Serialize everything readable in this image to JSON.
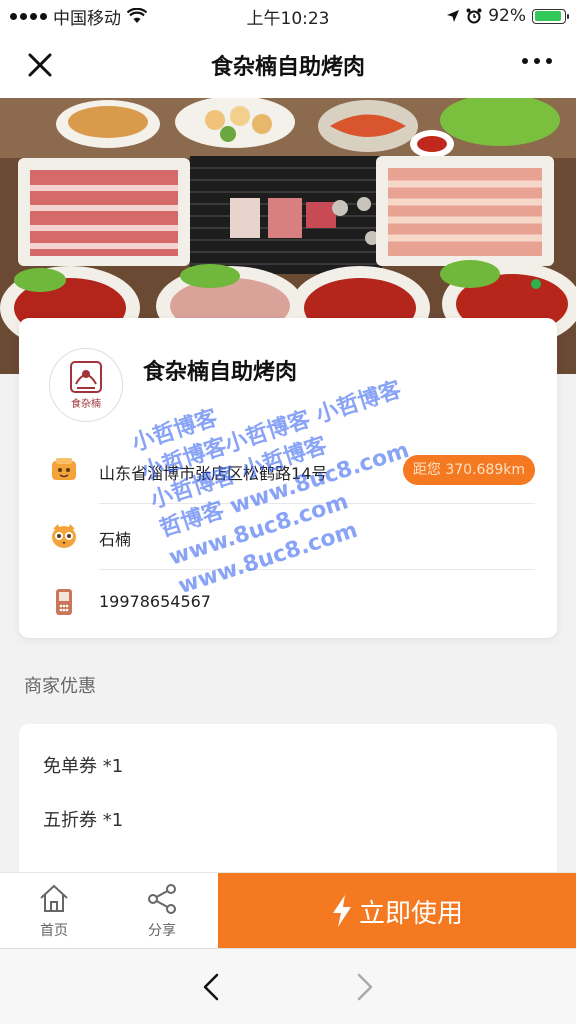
{
  "status_bar": {
    "carrier": "中国移动",
    "time": "上午10:23",
    "battery": "92%",
    "battery_level": 0.92
  },
  "nav": {
    "title": "食杂楠自助烤肉"
  },
  "store": {
    "name": "食杂楠自助烤肉",
    "logo_text": "食杂楠",
    "address": "山东省淄博市张店区松鹤路14号",
    "distance": "距您 370.689km",
    "contact": "石楠",
    "phone": "19978654567"
  },
  "discounts": {
    "title": "商家优惠",
    "items": [
      "免单券 *1",
      "五折券 *1"
    ]
  },
  "action_bar": {
    "home_label": "首页",
    "share_label": "分享",
    "use_label": "立即使用"
  },
  "watermark": {
    "lines": [
      "小哲博客",
      "小哲博客小哲博客 小哲博客",
      "小哲博客 小哲博客",
      "哲博客 www.8uc8.com",
      "www.8uc8.com",
      "www.8uc8.com"
    ]
  },
  "colors": {
    "accent": "#f47920",
    "watermark": "#2f5ff0"
  },
  "icons": [
    "wifi-icon",
    "location-arrow-icon",
    "alarm-icon",
    "close-icon",
    "more-icon",
    "address-icon",
    "contact-icon",
    "phone-icon",
    "home-icon",
    "share-icon",
    "lightning-icon",
    "back-icon",
    "forward-icon"
  ]
}
